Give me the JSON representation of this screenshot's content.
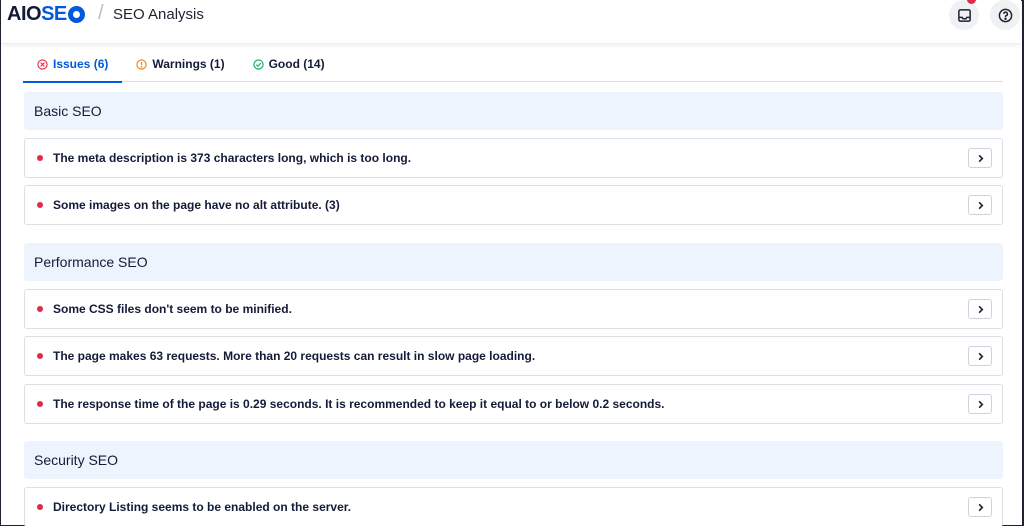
{
  "header": {
    "logo_prefix": "AIO",
    "logo_suffix_before": "SE",
    "breadcrumb_separator": "/",
    "page_title": "SEO Analysis",
    "icons": [
      "inbox-icon",
      "help-icon"
    ],
    "notification_color": "#df2a4a"
  },
  "tabs": [
    {
      "label": "Issues (6)",
      "icon": "error-circle-icon",
      "active": true,
      "color": "#df2a4a"
    },
    {
      "label": "Warnings (1)",
      "icon": "warning-circle-icon",
      "active": false,
      "color": "#f18200"
    },
    {
      "label": "Good (14)",
      "icon": "check-circle-icon",
      "active": false,
      "color": "#00aa63"
    }
  ],
  "sections": [
    {
      "title": "Basic SEO",
      "items": [
        "The meta description is 373 characters long, which is too long.",
        "Some images on the page have no alt attribute. (3)"
      ]
    },
    {
      "title": "Performance SEO",
      "items": [
        "Some CSS files don't seem to be minified.",
        "The page makes 63 requests. More than 20 requests can result in slow page loading.",
        "The response time of the page is 0.29 seconds. It is recommended to keep it equal to or below 0.2 seconds."
      ]
    },
    {
      "title": "Security SEO",
      "items": [
        "Directory Listing seems to be enabled on the server."
      ]
    }
  ],
  "colors": {
    "accent": "#005ae0",
    "issue_dot": "#df2a4a",
    "section_bg": "#eef4fe"
  }
}
